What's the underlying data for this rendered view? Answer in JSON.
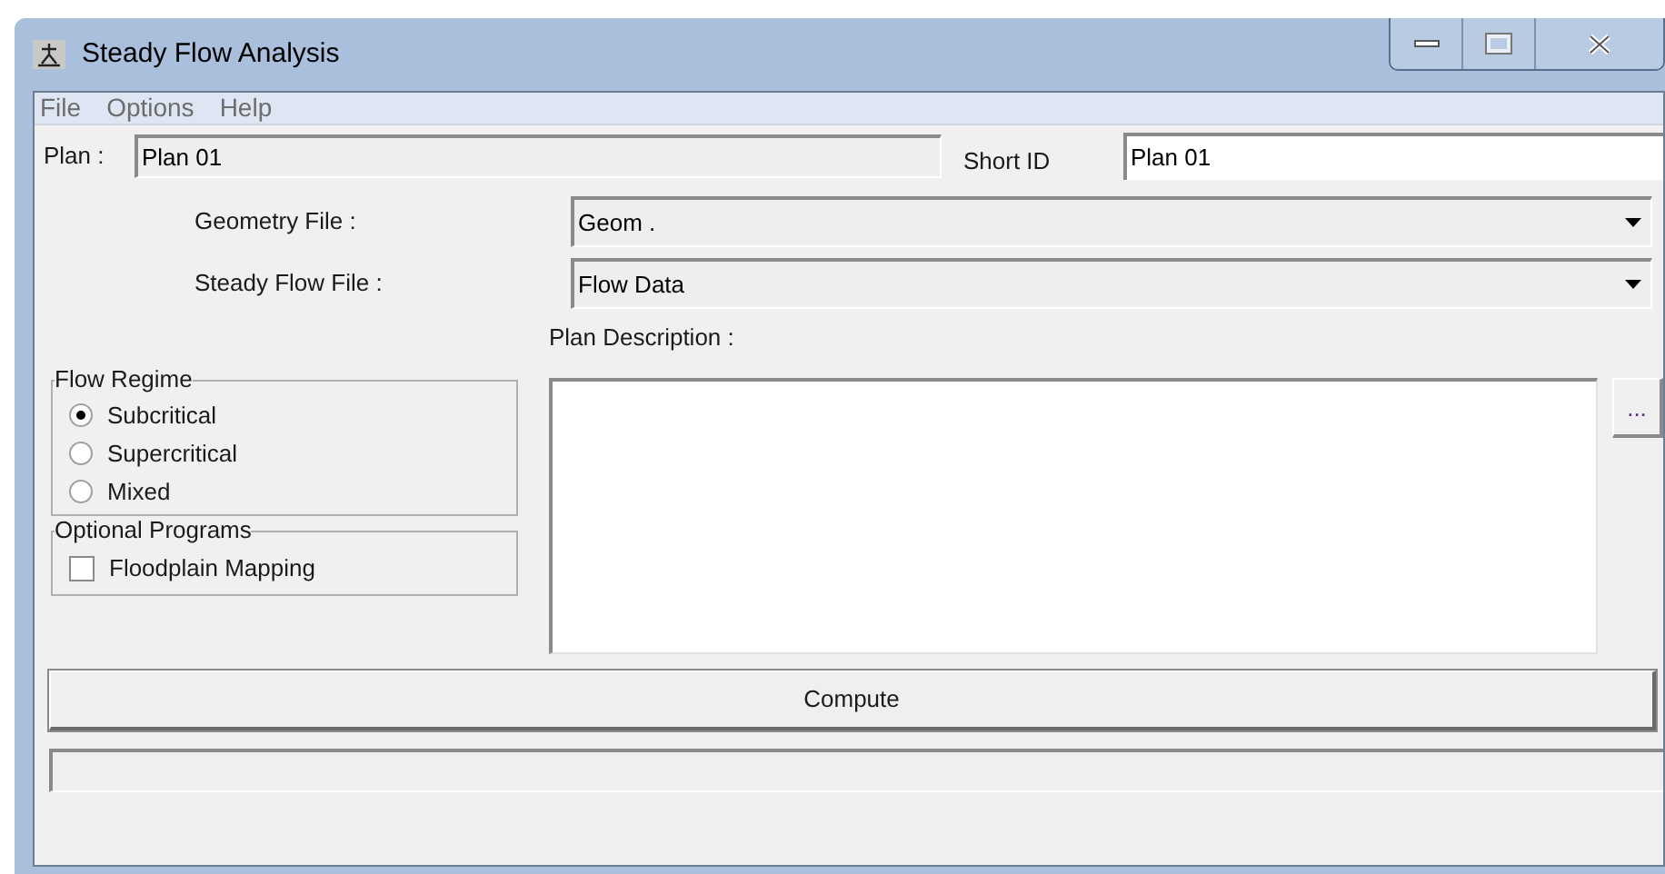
{
  "window": {
    "title": "Steady Flow Analysis"
  },
  "menu": [
    "File",
    "Options",
    "Help"
  ],
  "plan": {
    "label": "Plan :",
    "value": "Plan 01"
  },
  "short_id": {
    "label": "Short ID",
    "value": "Plan 01"
  },
  "geometry_file": {
    "label": "Geometry File :",
    "value": "Geom ."
  },
  "steady_flow_file": {
    "label": "Steady Flow File :",
    "value": "Flow Data"
  },
  "plan_description": {
    "label": "Plan Description :",
    "button": "..."
  },
  "flow_regime": {
    "title": "Flow Regime",
    "options": [
      {
        "label": "Subcritical",
        "selected": true
      },
      {
        "label": "Supercritical",
        "selected": false
      },
      {
        "label": "Mixed",
        "selected": false
      }
    ]
  },
  "optional_programs": {
    "title": "Optional Programs",
    "options": [
      {
        "label": "Floodplain Mapping",
        "checked": false
      }
    ]
  },
  "compute_button": "Compute"
}
